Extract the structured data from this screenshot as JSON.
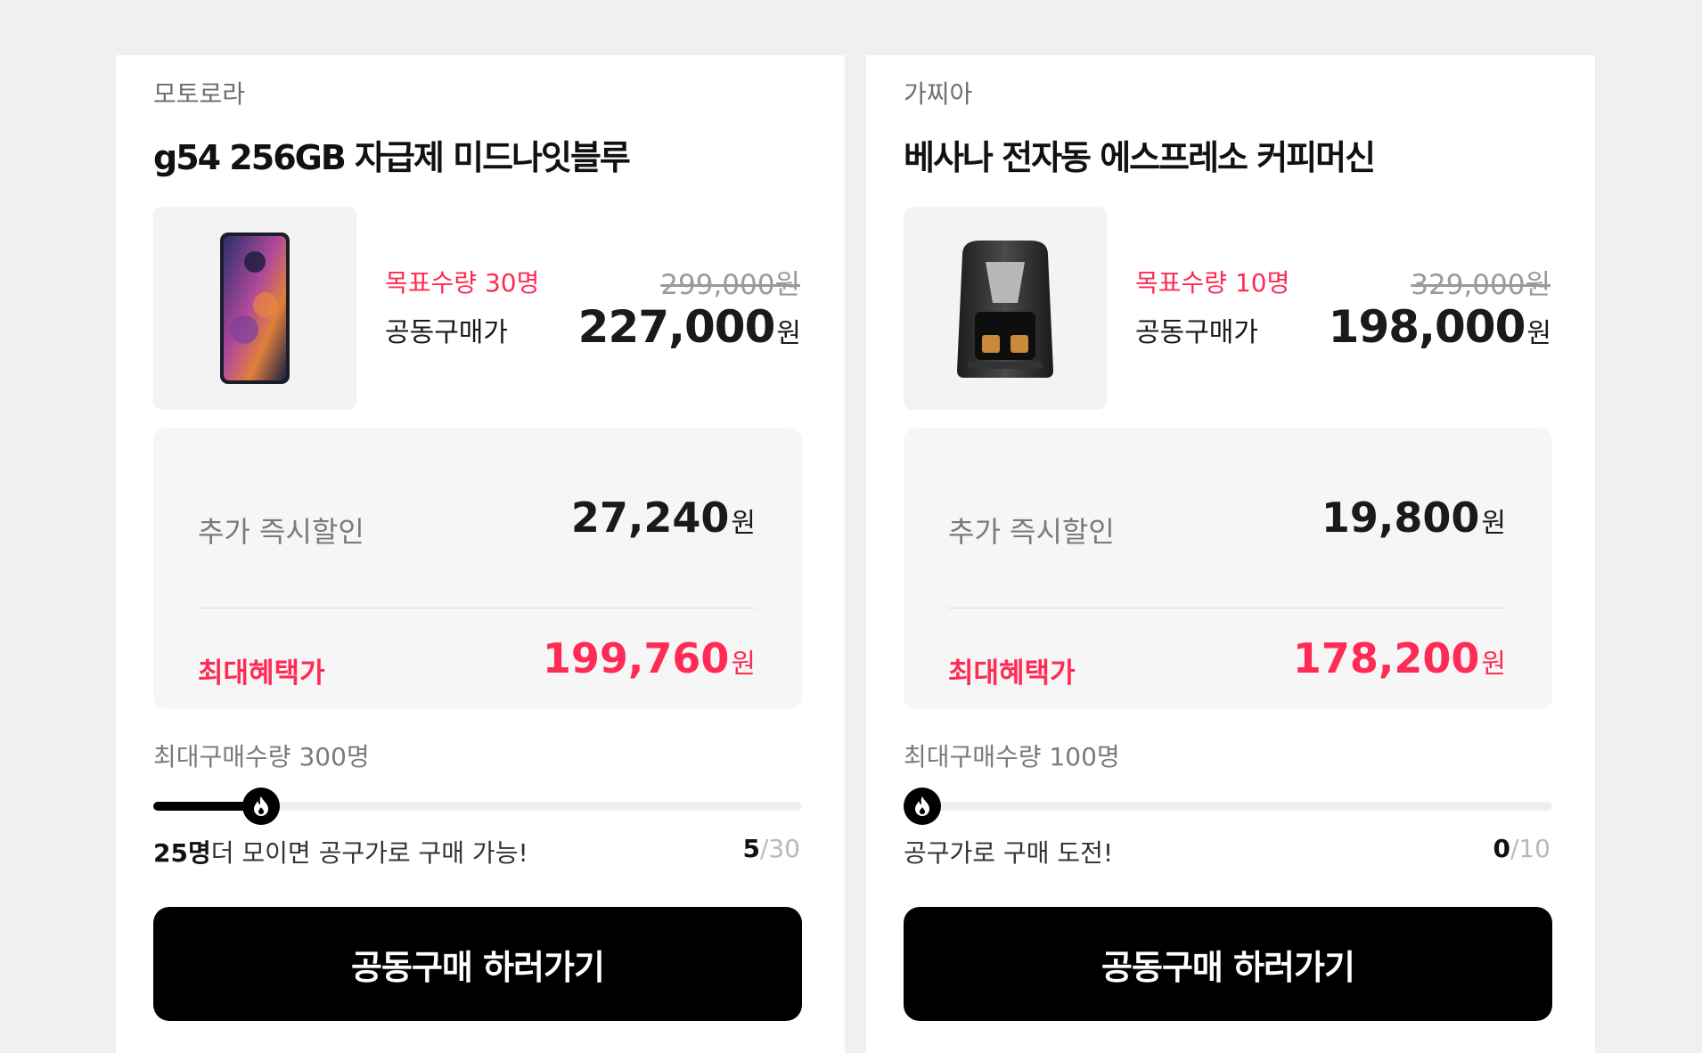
{
  "products": [
    {
      "brand": "모토로라",
      "title": "g54 256GB 자급제 미드나잇블루",
      "target_label": "목표수량 30명",
      "original_price": "299,000",
      "group_buy_label": "공동구매가",
      "group_buy_price": "227,000",
      "currency": "원",
      "instant_discount_label": "추가 즉시할인",
      "instant_discount_value": "27,240",
      "max_benefit_label": "최대혜택가",
      "max_benefit_price": "199,760",
      "max_purchase_label": "최대구매수량 300명",
      "progress": {
        "current": 5,
        "goal": 30,
        "fraction": 0.167
      },
      "status_highlight": "25명",
      "status_text": "더 모이면 공구가로 구매 가능!",
      "count_current": "5",
      "count_total": "/30",
      "cta_label": "공동구매 하러가기",
      "image_icon": "smartphone-icon"
    },
    {
      "brand": "가찌아",
      "title": "베사나 전자동 에스프레소 커피머신",
      "target_label": "목표수량 10명",
      "original_price": "329,000",
      "group_buy_label": "공동구매가",
      "group_buy_price": "198,000",
      "currency": "원",
      "instant_discount_label": "추가 즉시할인",
      "instant_discount_value": "19,800",
      "max_benefit_label": "최대혜택가",
      "max_benefit_price": "178,200",
      "max_purchase_label": "최대구매수량 100명",
      "progress": {
        "current": 0,
        "goal": 10,
        "fraction": 0.0
      },
      "status_highlight": "",
      "status_text": "공구가로 구매 도전!",
      "count_current": "0",
      "count_total": "/10",
      "cta_label": "공동구매 하러가기",
      "image_icon": "coffee-machine-icon"
    }
  ],
  "colors": {
    "accent": "#ff2b55",
    "cta_bg": "#000000",
    "muted": "#7a7a7a"
  }
}
